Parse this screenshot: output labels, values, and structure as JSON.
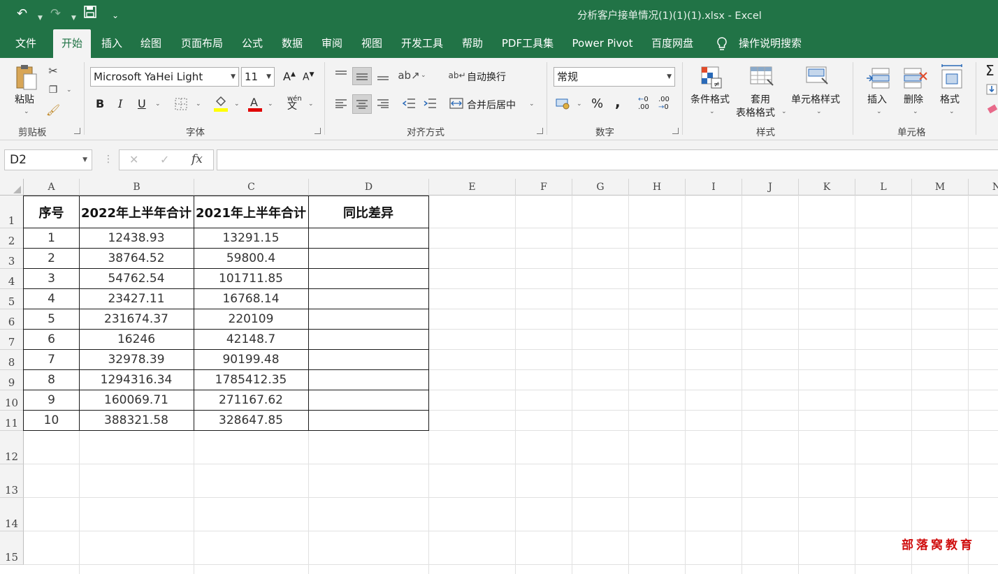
{
  "window": {
    "title": "分析客户接单情况(1)(1)(1).xlsx  -  Excel"
  },
  "qat": {
    "undo": "↶",
    "redo": "↷",
    "save": "💾",
    "more": "⌄"
  },
  "tabs": [
    "文件",
    "开始",
    "插入",
    "绘图",
    "页面布局",
    "公式",
    "数据",
    "审阅",
    "视图",
    "开发工具",
    "帮助",
    "PDF工具集",
    "Power Pivot",
    "百度网盘",
    "操作说明搜索"
  ],
  "active_tab": "开始",
  "ribbon": {
    "clipboard": {
      "label": "剪贴板",
      "paste": "粘贴"
    },
    "font": {
      "label": "字体",
      "name": "Microsoft YaHei Light",
      "size": "11",
      "bold": "B",
      "italic": "I",
      "underline": "U",
      "grow": "A",
      "shrink": "A",
      "phonetic": "wén"
    },
    "alignment": {
      "label": "对齐方式",
      "wrap": "自动换行",
      "merge": "合并后居中"
    },
    "number": {
      "label": "数字",
      "format": "常规",
      "percent": "%",
      "comma": ",",
      "inc": ".00",
      "dec": ".00"
    },
    "styles": {
      "label": "样式",
      "conditional": "条件格式",
      "table1": "套用",
      "table2": "表格格式",
      "cell_styles": "单元格样式"
    },
    "cells": {
      "label": "单元格",
      "insert": "插入",
      "delete": "删除",
      "format": "格式"
    },
    "editing": {
      "sum": "Σ"
    }
  },
  "formula_bar": {
    "name_box": "D2",
    "fx": "fx",
    "cancel": "✕",
    "enter": "✓",
    "value": ""
  },
  "columns": [
    "A",
    "B",
    "C",
    "D",
    "E",
    "F",
    "G",
    "H",
    "I",
    "J",
    "K",
    "L",
    "M",
    "N"
  ],
  "rows": [
    "1",
    "2",
    "3",
    "4",
    "5",
    "6",
    "7",
    "8",
    "9",
    "10",
    "11",
    "12",
    "13",
    "14",
    "15"
  ],
  "table": {
    "headers": [
      "序号",
      "2022年上半年合计",
      "2021年上半年合计",
      "同比差异"
    ],
    "data": [
      [
        "1",
        "12438.93",
        "13291.15",
        ""
      ],
      [
        "2",
        "38764.52",
        "59800.4",
        ""
      ],
      [
        "3",
        "54762.54",
        "101711.85",
        ""
      ],
      [
        "4",
        "23427.11",
        "16768.14",
        ""
      ],
      [
        "5",
        "231674.37",
        "220109",
        ""
      ],
      [
        "6",
        "16246",
        "42148.7",
        ""
      ],
      [
        "7",
        "32978.39",
        "90199.48",
        ""
      ],
      [
        "8",
        "1294316.34",
        "1785412.35",
        ""
      ],
      [
        "9",
        "160069.71",
        "271167.62",
        ""
      ],
      [
        "10",
        "388321.58",
        "328647.85",
        ""
      ]
    ]
  },
  "watermark": "部落窝教育",
  "colors": {
    "excel_green": "#217346",
    "ribbon_bg": "#f3f3f3"
  }
}
